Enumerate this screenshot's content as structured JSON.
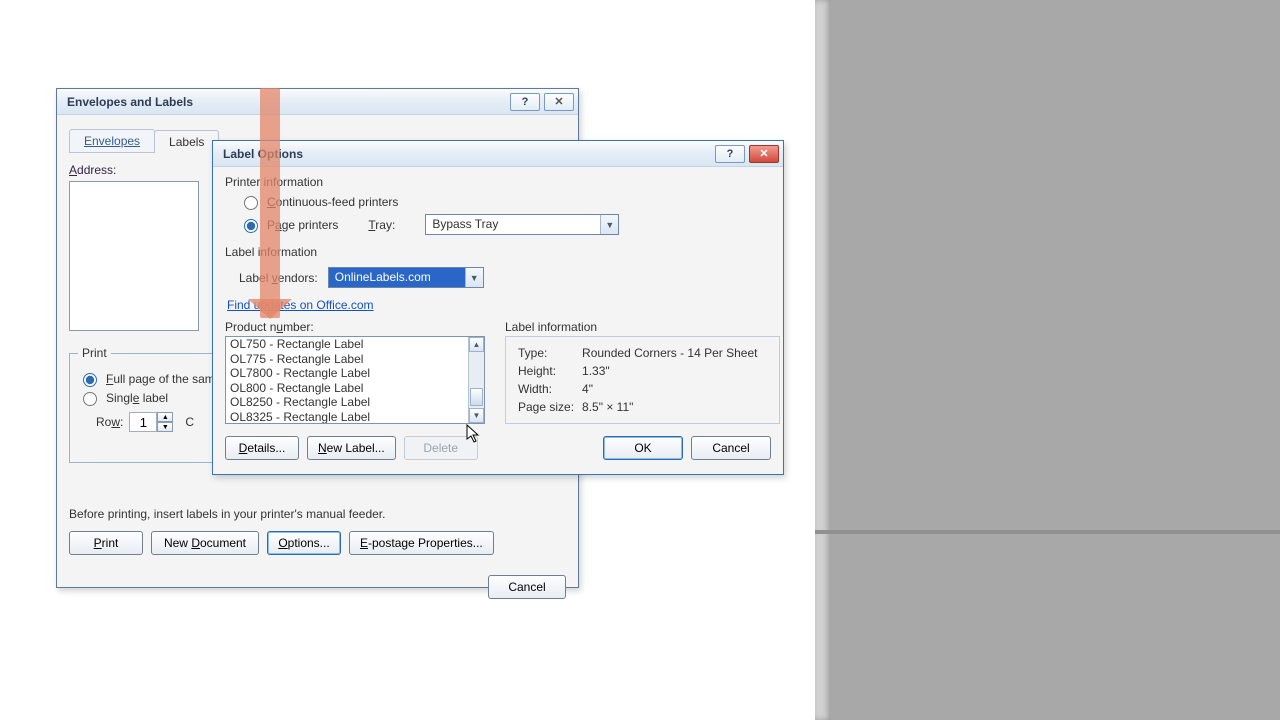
{
  "rightpane": {},
  "parentDialog": {
    "title": "Envelopes and Labels",
    "tabs": {
      "envelopes": "Envelopes",
      "labels": "Labels"
    },
    "addressLabel": "Address:",
    "printLegend": "Print",
    "fullPage": "Full page of the sam",
    "singleLabel": "Single label",
    "rowLabel": "Row:",
    "rowVal": "1",
    "colHint": "C",
    "beforePrinting": "Before printing, insert labels in your printer's manual feeder.",
    "printBtn": "Print",
    "newDoc": "New Document",
    "optionsBtn": "Options...",
    "epost": "E-postage Properties...",
    "cancel": "Cancel"
  },
  "childDialog": {
    "title": "Label Options",
    "printerInfo": "Printer information",
    "continuous": "Continuous-feed printers",
    "pagePrinters": "Page printers",
    "trayLabel": "Tray:",
    "trayVal": "Bypass Tray",
    "labelInfoSection": "Label information",
    "vendorsLabel": "Label vendors:",
    "vendorsVal": "OnlineLabels.com",
    "updatesLink": "Find updates on Office.com",
    "productNumberLabel": "Product number:",
    "productList": [
      "OL750 - Rectangle Label",
      "OL775 - Rectangle Label",
      "OL7800 - Rectangle Label",
      "OL800 - Rectangle Label",
      "OL8250 - Rectangle Label",
      "OL8325 - Rectangle Label"
    ],
    "infoTitle": "Label information",
    "info": {
      "typeLabel": "Type:",
      "typeVal": "Rounded Corners - 14 Per Sheet",
      "heightLabel": "Height:",
      "heightVal": "1.33\"",
      "widthLabel": "Width:",
      "widthVal": "4\"",
      "pageLabel": "Page size:",
      "pageVal": "8.5\" × 11\""
    },
    "detailsBtn": "Details...",
    "newLabelBtn": "New Label...",
    "deleteBtn": "Delete",
    "okBtn": "OK",
    "cancelBtn": "Cancel"
  }
}
